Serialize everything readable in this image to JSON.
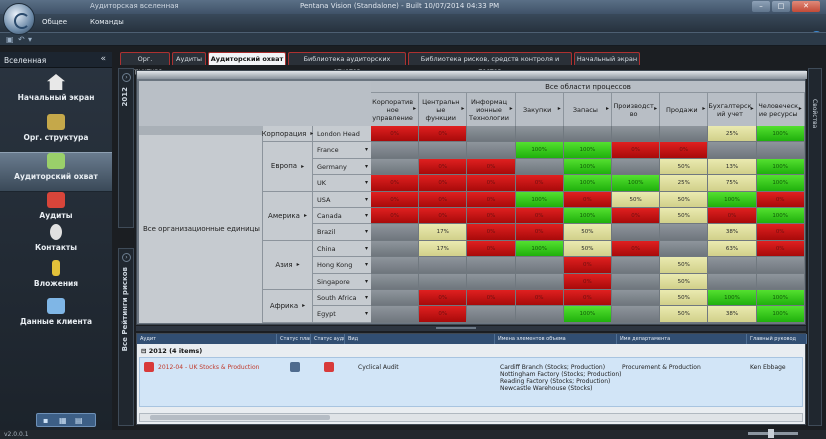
{
  "window": {
    "app_title": "Аудиторская вселенная",
    "title": "Pentana Vision (Standalone) - Built 10/07/2014 04:33 PM"
  },
  "menubar": {
    "items": [
      "Общее",
      "Команды"
    ]
  },
  "statusbar": {
    "version": "v2.0.0.1"
  },
  "sidebar": {
    "header": "Вселенная",
    "collapse_glyph": "«",
    "items": [
      {
        "label": "Начальный экран",
        "icon": "home-icon",
        "color": "#e8e8e8"
      },
      {
        "label": "Орг. структура",
        "icon": "org-chart-icon",
        "color": "#c5a84a"
      },
      {
        "label": "Аудиторский охват",
        "icon": "coverage-icon",
        "color": "#9ad06a",
        "active": true
      },
      {
        "label": "Аудиты",
        "icon": "audit-icon",
        "color": "#d8453a"
      },
      {
        "label": "Контакты",
        "icon": "contact-icon",
        "color": "#e0e0e0"
      },
      {
        "label": "Вложения",
        "icon": "attachment-icon",
        "color": "#e3c13a"
      },
      {
        "label": "Данные клиента",
        "icon": "client-data-icon",
        "color": "#7fb6e6"
      }
    ]
  },
  "tabs": [
    {
      "label": "Орг. структура"
    },
    {
      "label": "Аудиты"
    },
    {
      "label": "Аудиторский охват",
      "active": true
    },
    {
      "label": "Библиотека аудиторских отчетов"
    },
    {
      "label": "Библиотека рисков, средств контроля и тестов"
    },
    {
      "label": "Начальный экран"
    }
  ],
  "left_strip": {
    "year": "2012",
    "caption": "Все Рейтинги рисков"
  },
  "right_strip": {
    "caption": "Свойства"
  },
  "matrix": {
    "top_header": "Все области процессов",
    "columns": [
      "Корпоратив ное управление",
      "Центральн ые функции",
      "Информац ионные Технологии",
      "Закупки",
      "Запасы",
      "Производст во",
      "Продажи",
      "Бухгалтерск ий учет",
      "Человеческ ие ресурсы"
    ],
    "root_row": "Все организационные единицы",
    "corp_row": {
      "region": "Корпорация",
      "unit": "London Head Office"
    },
    "regions": [
      {
        "name": "Европа",
        "countries": [
          "France",
          "Germany",
          "UK"
        ]
      },
      {
        "name": "Америка",
        "countries": [
          "USA",
          "Canada",
          "Brazil"
        ]
      },
      {
        "name": "Азия",
        "countries": [
          "China",
          "Hong Kong",
          "Singapore"
        ]
      },
      {
        "name": "Африка",
        "countries": [
          "South Africa",
          "Egypt"
        ]
      }
    ],
    "rows": [
      {
        "unit": "London Head Office",
        "cells": [
          [
            "r",
            "0%"
          ],
          [
            "r",
            "0%"
          ],
          [
            "n",
            ""
          ],
          [
            "n",
            ""
          ],
          [
            "n",
            ""
          ],
          [
            "n",
            ""
          ],
          [
            "n",
            ""
          ],
          [
            "y",
            "25%"
          ],
          [
            "g",
            "100%"
          ]
        ]
      },
      {
        "unit": "France",
        "cells": [
          [
            "n",
            ""
          ],
          [
            "n",
            ""
          ],
          [
            "n",
            ""
          ],
          [
            "g",
            "100%"
          ],
          [
            "g",
            "100%"
          ],
          [
            "r",
            "0%"
          ],
          [
            "r",
            "0%"
          ],
          [
            "n",
            ""
          ],
          [
            "n",
            ""
          ]
        ]
      },
      {
        "unit": "Germany",
        "cells": [
          [
            "n",
            ""
          ],
          [
            "r",
            "0%"
          ],
          [
            "r",
            "0%"
          ],
          [
            "n",
            ""
          ],
          [
            "g",
            "100%"
          ],
          [
            "n",
            ""
          ],
          [
            "y",
            "50%"
          ],
          [
            "y",
            "13%"
          ],
          [
            "g",
            "100%"
          ]
        ]
      },
      {
        "unit": "UK",
        "cells": [
          [
            "r",
            "0%"
          ],
          [
            "r",
            "0%"
          ],
          [
            "r",
            "0%"
          ],
          [
            "r",
            "0%"
          ],
          [
            "g",
            "100%"
          ],
          [
            "g",
            "100%"
          ],
          [
            "y",
            "25%"
          ],
          [
            "y",
            "75%"
          ],
          [
            "g",
            "100%"
          ]
        ]
      },
      {
        "unit": "USA",
        "cells": [
          [
            "r",
            "0%"
          ],
          [
            "r",
            "0%"
          ],
          [
            "r",
            "0%"
          ],
          [
            "g",
            "100%"
          ],
          [
            "r",
            "0%"
          ],
          [
            "y",
            "50%"
          ],
          [
            "y",
            "50%"
          ],
          [
            "g",
            "100%"
          ],
          [
            "r",
            "0%"
          ]
        ]
      },
      {
        "unit": "Canada",
        "cells": [
          [
            "r",
            "0%"
          ],
          [
            "r",
            "0%"
          ],
          [
            "r",
            "0%"
          ],
          [
            "r",
            "0%"
          ],
          [
            "g",
            "100%"
          ],
          [
            "r",
            "0%"
          ],
          [
            "y",
            "50%"
          ],
          [
            "r",
            "0%"
          ],
          [
            "g",
            "100%"
          ]
        ]
      },
      {
        "unit": "Brazil",
        "cells": [
          [
            "n",
            ""
          ],
          [
            "y",
            "17%"
          ],
          [
            "r",
            "0%"
          ],
          [
            "r",
            "0%"
          ],
          [
            "y",
            "50%"
          ],
          [
            "n",
            ""
          ],
          [
            "n",
            ""
          ],
          [
            "y",
            "38%"
          ],
          [
            "r",
            "0%"
          ]
        ]
      },
      {
        "unit": "China",
        "cells": [
          [
            "n",
            ""
          ],
          [
            "y",
            "17%"
          ],
          [
            "r",
            "0%"
          ],
          [
            "g",
            "100%"
          ],
          [
            "y",
            "50%"
          ],
          [
            "r",
            "0%"
          ],
          [
            "n",
            ""
          ],
          [
            "y",
            "63%"
          ],
          [
            "r",
            "0%"
          ]
        ]
      },
      {
        "unit": "Hong Kong",
        "cells": [
          [
            "n",
            ""
          ],
          [
            "n",
            ""
          ],
          [
            "n",
            ""
          ],
          [
            "n",
            ""
          ],
          [
            "r",
            "0%"
          ],
          [
            "n",
            ""
          ],
          [
            "y",
            "50%"
          ],
          [
            "n",
            ""
          ],
          [
            "n",
            ""
          ]
        ]
      },
      {
        "unit": "Singapore",
        "cells": [
          [
            "n",
            ""
          ],
          [
            "n",
            ""
          ],
          [
            "n",
            ""
          ],
          [
            "n",
            ""
          ],
          [
            "r",
            "0%"
          ],
          [
            "n",
            ""
          ],
          [
            "y",
            "50%"
          ],
          [
            "n",
            ""
          ],
          [
            "n",
            ""
          ]
        ]
      },
      {
        "unit": "South Africa",
        "cells": [
          [
            "n",
            ""
          ],
          [
            "r",
            "0%"
          ],
          [
            "r",
            "0%"
          ],
          [
            "r",
            "0%"
          ],
          [
            "r",
            "0%"
          ],
          [
            "n",
            ""
          ],
          [
            "y",
            "50%"
          ],
          [
            "g",
            "100%"
          ],
          [
            "g",
            "100%"
          ]
        ]
      },
      {
        "unit": "Egypt",
        "cells": [
          [
            "n",
            ""
          ],
          [
            "r",
            "0%"
          ],
          [
            "n",
            ""
          ],
          [
            "n",
            ""
          ],
          [
            "g",
            "100%"
          ],
          [
            "n",
            ""
          ],
          [
            "y",
            "50%"
          ],
          [
            "y",
            "38%"
          ],
          [
            "g",
            "100%"
          ]
        ]
      }
    ],
    "colors": {
      "r": "#d01818",
      "g": "#3ccc20",
      "y": "#e0dfa0",
      "n": "#7f868d"
    }
  },
  "audits_table": {
    "columns": [
      "Аудит",
      "Статус план",
      "Статус ауди",
      "Вид",
      "Имена элементов объема",
      "Имя департамента",
      "Главный руковод"
    ],
    "group": "2012 (4 items)",
    "row": {
      "title": "2012-04 - UK Stocks & Production",
      "type": "Cyclical Audit",
      "scope": [
        "Cardiff Branch (Stocks; Production)",
        "Nottingham Factory (Stocks; Production)",
        "Reading Factory (Stocks; Production)",
        "Newcastle Warehouse (Stocks)"
      ],
      "department": "Procurement & Production",
      "lead": "Ken Ebbage"
    }
  }
}
